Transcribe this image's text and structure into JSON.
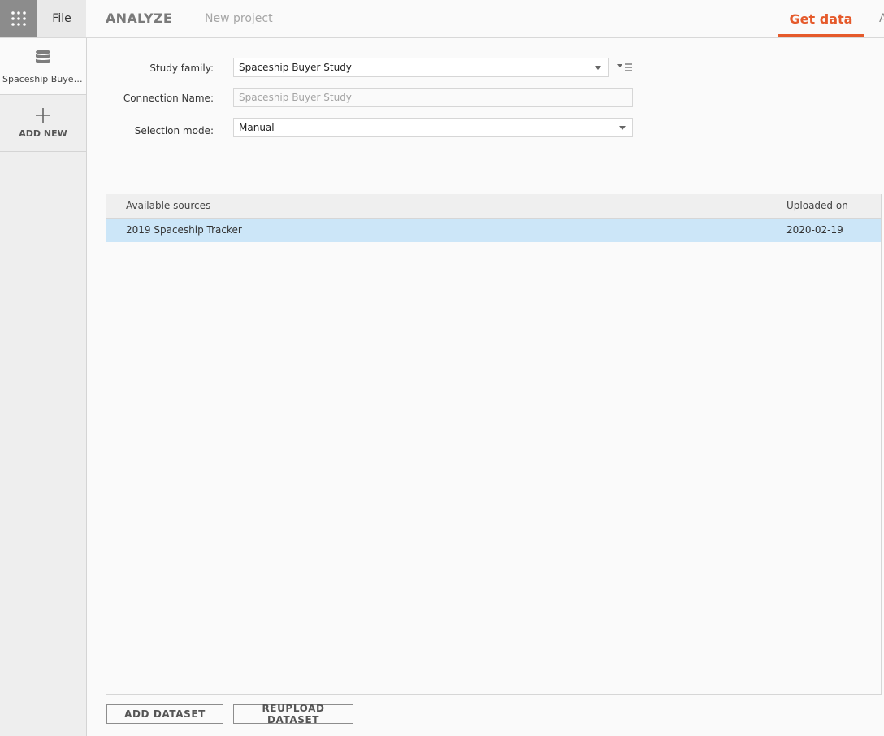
{
  "header": {
    "file_label": "File",
    "app_title": "ANALYZE",
    "project_name": "New project",
    "active_tab": "Get data",
    "overflow_tab_glyph": "A"
  },
  "sidebar": {
    "items": [
      {
        "label": "Spaceship Buyer Study",
        "icon": "database-icon"
      }
    ],
    "add_new_label": "ADD NEW"
  },
  "form": {
    "study_family_label": "Study family:",
    "study_family_value": "Spaceship Buyer Study",
    "connection_name_label": "Connection Name:",
    "connection_name_value": "Spaceship Buyer Study",
    "selection_mode_label": "Selection mode:",
    "selection_mode_value": "Manual"
  },
  "table": {
    "columns": [
      "Available sources",
      "Uploaded on"
    ],
    "rows": [
      {
        "source": "2019 Spaceship Tracker",
        "uploaded_on": "2020-02-19",
        "selected": true
      }
    ]
  },
  "buttons": {
    "add_dataset": "ADD DATASET",
    "reupload_dataset": "REUPLOAD DATASET"
  },
  "colors": {
    "accent": "#e55a2b",
    "selection": "#cce6f8",
    "apps_button": "#8c8c8c"
  }
}
